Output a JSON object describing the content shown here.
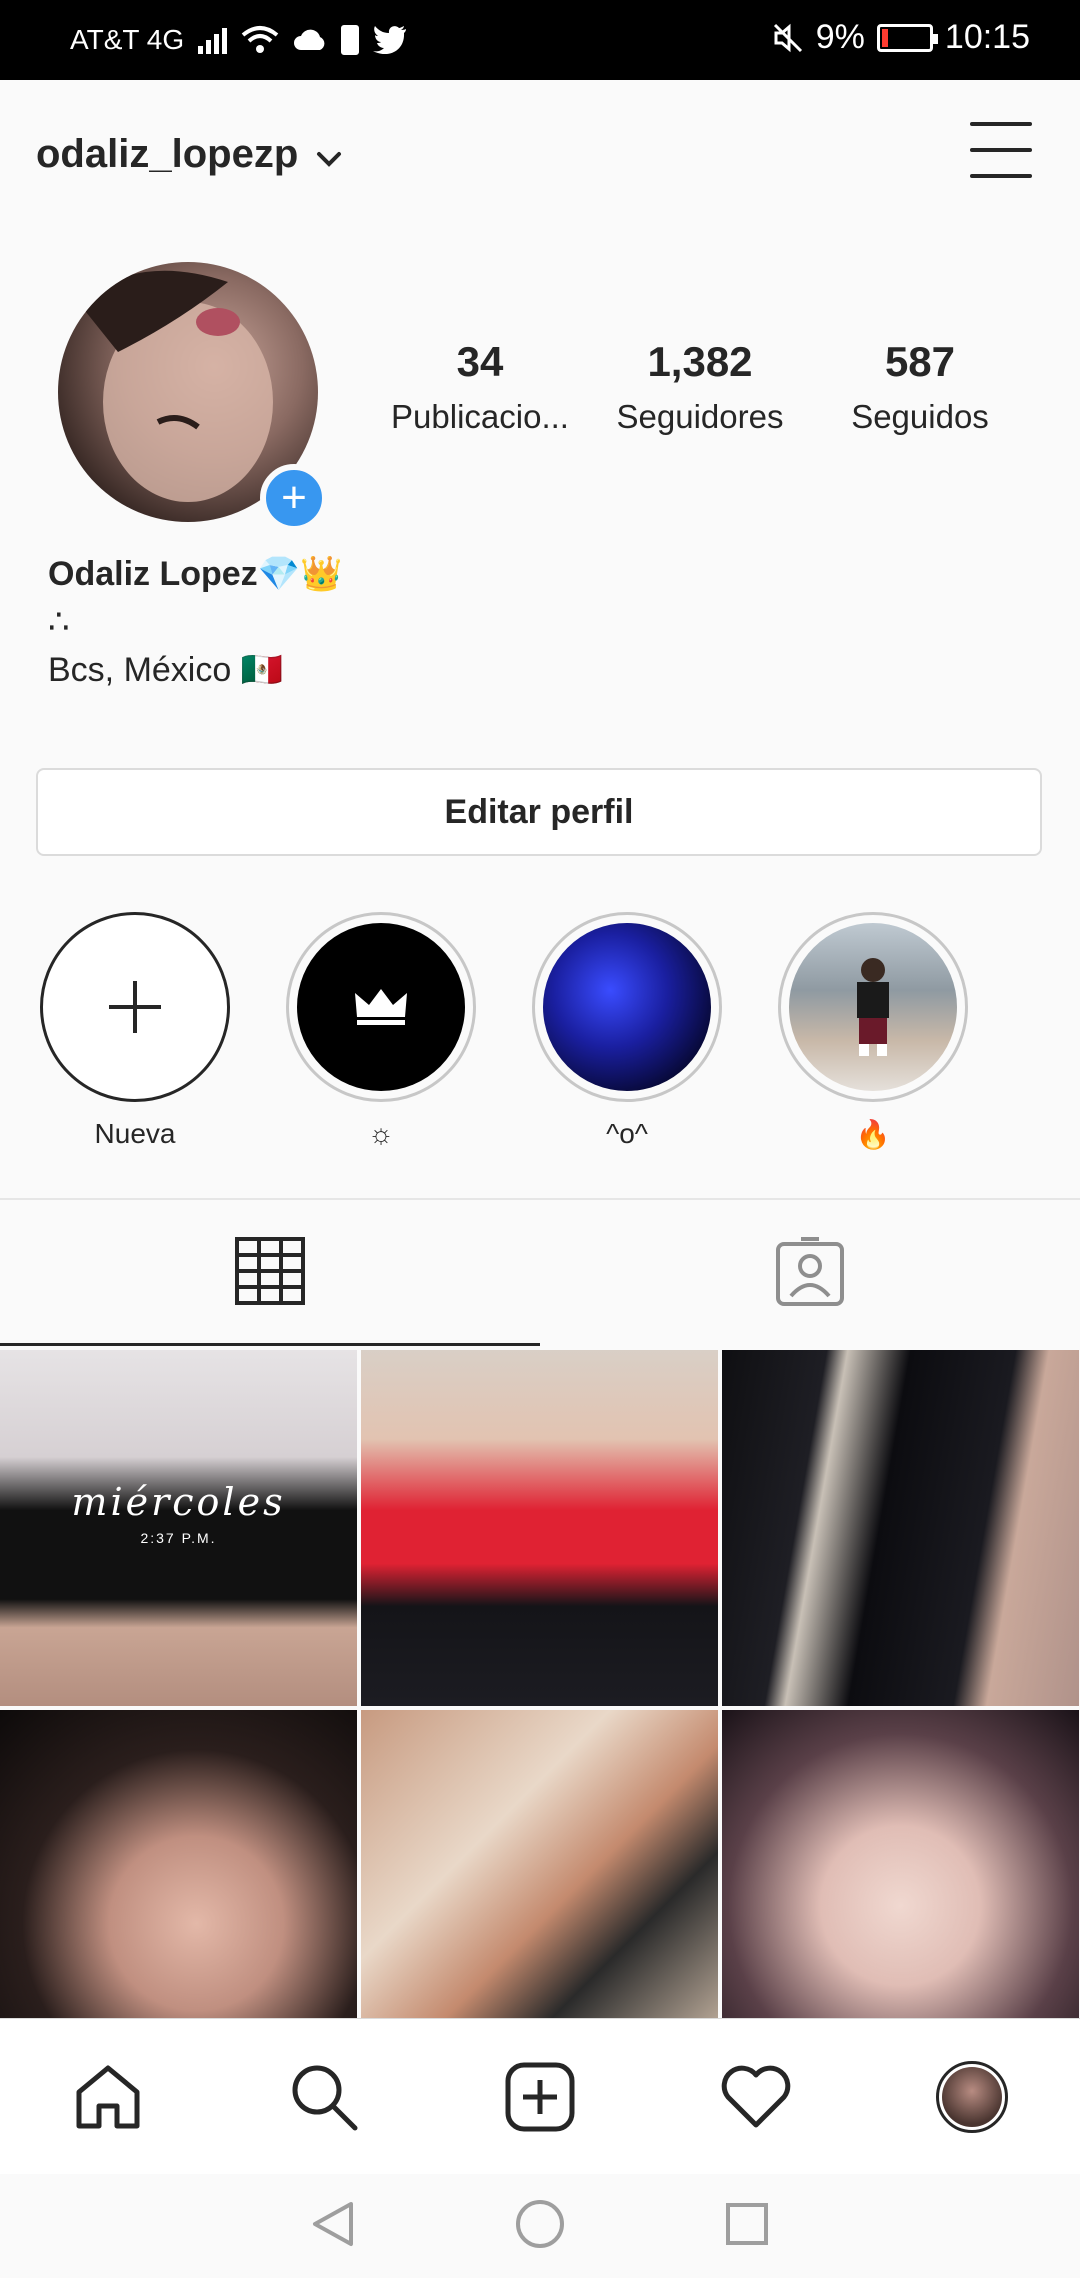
{
  "status_bar": {
    "carrier": "AT&T 4G",
    "battery_percent": "9%",
    "time": "10:15",
    "icons": [
      "signal-icon",
      "wifi-icon",
      "cloud-icon",
      "battery-saver-icon",
      "twitter-icon",
      "mute-icon",
      "battery-icon"
    ]
  },
  "header": {
    "username": "odaliz_lopezp",
    "dropdown_icon": "chevron-down-icon",
    "menu_icon": "hamburger-menu-icon"
  },
  "profile": {
    "stats": [
      {
        "value": "34",
        "label": "Publicacio..."
      },
      {
        "value": "1,382",
        "label": "Seguidores"
      },
      {
        "value": "587",
        "label": "Seguidos"
      }
    ],
    "name": "Odaliz Lopez💎👑",
    "bio_line": "∴",
    "location": "Bcs, México 🇲🇽",
    "edit_button": "Editar perfil"
  },
  "highlights": [
    {
      "label": "Nueva"
    },
    {
      "label": "☼"
    },
    {
      "label": "^o^"
    },
    {
      "label": "🔥"
    }
  ],
  "tabs": [
    "grid-icon",
    "tagged-icon"
  ],
  "grid": {
    "first_post_caption": "miércoles",
    "first_post_subcaption": "2:37 P.M."
  },
  "bottom_nav": [
    "home-icon",
    "search-icon",
    "add-post-icon",
    "activity-heart-icon",
    "profile-avatar"
  ],
  "colors": {
    "accent_blue": "#3897f0",
    "text": "#262626",
    "border": "#dbdbdb",
    "battery_low": "#ff3b30"
  }
}
